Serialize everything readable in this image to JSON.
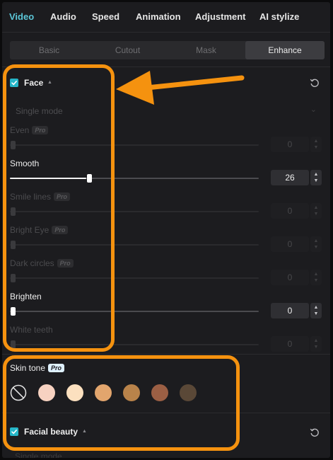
{
  "topnav": {
    "tabs": [
      {
        "label": "Video",
        "active": true
      },
      {
        "label": "Audio",
        "active": false
      },
      {
        "label": "Speed",
        "active": false
      },
      {
        "label": "Animation",
        "active": false
      },
      {
        "label": "Adjustment",
        "active": false
      },
      {
        "label": "AI stylize",
        "active": false
      }
    ]
  },
  "subtabs": [
    {
      "label": "Basic",
      "active": false
    },
    {
      "label": "Cutout",
      "active": false
    },
    {
      "label": "Mask",
      "active": false
    },
    {
      "label": "Enhance",
      "active": true
    }
  ],
  "face": {
    "title": "Face",
    "checked": true,
    "mode": "Single mode",
    "sliders": [
      {
        "label": "Even",
        "pro": true,
        "enabled": false,
        "value": "0",
        "level": 0
      },
      {
        "label": "Smooth",
        "pro": false,
        "enabled": true,
        "value": "26",
        "level": 26
      },
      {
        "label": "Smile lines",
        "pro": true,
        "enabled": false,
        "value": "0",
        "level": 0
      },
      {
        "label": "Bright Eye",
        "pro": true,
        "enabled": false,
        "value": "0",
        "level": 0
      },
      {
        "label": "Dark circles",
        "pro": true,
        "enabled": false,
        "value": "0",
        "level": 0
      },
      {
        "label": "Brighten",
        "pro": false,
        "enabled": true,
        "value": "0",
        "level": 0
      },
      {
        "label": "White teeth",
        "pro": false,
        "enabled": false,
        "value": "0",
        "level": 0
      }
    ]
  },
  "skin_tone": {
    "label": "Skin tone",
    "pro": "Pro",
    "swatches": [
      "none",
      "#f7d2c1",
      "#fce0bf",
      "#e2a56d",
      "#b9834a",
      "#9b5f44",
      "#5a4837"
    ]
  },
  "facial_beauty": {
    "title": "Facial beauty",
    "checked": true
  },
  "partial_below": "Single mode",
  "pro_badge": "Pro",
  "colors": {
    "accent": "#5cc7d8",
    "annotation": "#f5920f",
    "checkbox": "#26b6c8"
  },
  "icons": {
    "reset": "reset-icon",
    "checkbox": "checkmark-icon",
    "dropdown": "chevron-down-icon",
    "annotation": "arrow-icon"
  }
}
